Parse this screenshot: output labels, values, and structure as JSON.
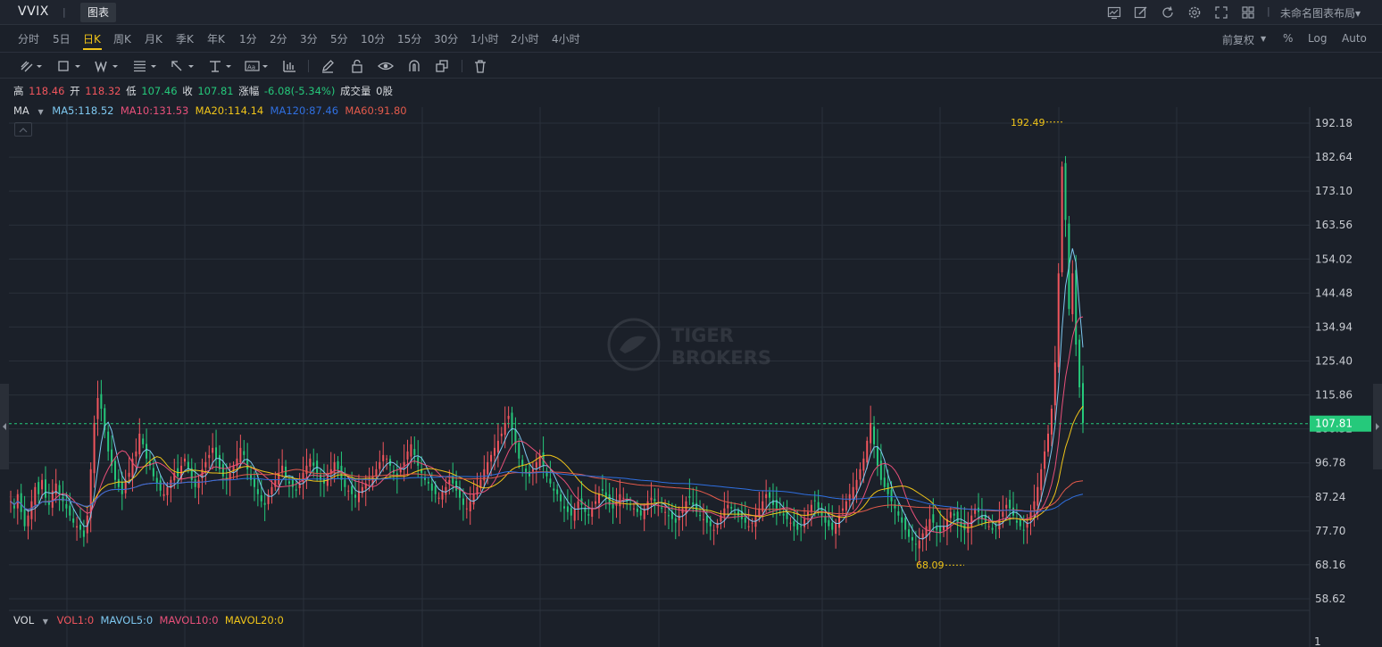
{
  "header": {
    "symbol": "VVIX",
    "separator": "|",
    "tab_label": "图表",
    "layout_label": "未命名图表布局▾"
  },
  "periods": [
    {
      "label": "分时",
      "active": false
    },
    {
      "label": "5日",
      "active": false
    },
    {
      "label": "日K",
      "active": true
    },
    {
      "label": "周K",
      "active": false
    },
    {
      "label": "月K",
      "active": false
    },
    {
      "label": "季K",
      "active": false
    },
    {
      "label": "年K",
      "active": false
    },
    {
      "label": "1分",
      "active": false
    },
    {
      "label": "2分",
      "active": false
    },
    {
      "label": "3分",
      "active": false
    },
    {
      "label": "5分",
      "active": false
    },
    {
      "label": "10分",
      "active": false
    },
    {
      "label": "15分",
      "active": false
    },
    {
      "label": "30分",
      "active": false
    },
    {
      "label": "1小时",
      "active": false
    },
    {
      "label": "2小时",
      "active": false
    },
    {
      "label": "4小时",
      "active": false
    }
  ],
  "right_options": {
    "adjust": "前复权",
    "percent": "%",
    "log": "Log",
    "auto": "Auto"
  },
  "quote": {
    "high_label": "高",
    "high": "118.46",
    "open_label": "开",
    "open": "118.32",
    "low_label": "低",
    "low": "107.46",
    "close_label": "收",
    "close": "107.81",
    "change_label": "涨幅",
    "change": "-6.08(-5.34%)",
    "volume_label": "成交量",
    "volume": "0股"
  },
  "ma": {
    "label": "MA",
    "ma5": "MA5:118.52",
    "ma10": "MA10:131.53",
    "ma20": "MA20:114.14",
    "ma120": "MA120:87.46",
    "ma60": "MA60:91.80"
  },
  "vol": {
    "label": "VOL",
    "vol1": "VOL1:0",
    "mavol5": "MAVOL5:0",
    "mavol10": "MAVOL10:0",
    "mavol20": "MAVOL20:0"
  },
  "colors": {
    "up": "#f0555d",
    "down": "#25c97b",
    "ma5": "#7ec8f0",
    "ma10": "#e8507a",
    "ma20": "#f0c419",
    "ma60": "#e35a4b",
    "ma120": "#2f6fe0",
    "last_price_bg": "#25c97b"
  },
  "watermark": {
    "line1": "TIGER",
    "line2": "BROKERS"
  },
  "chart_data": {
    "type": "candlestick",
    "y_ticks": [
      "192.18",
      "182.64",
      "173.10",
      "163.56",
      "154.02",
      "144.48",
      "134.94",
      "125.40",
      "115.86",
      "106.32",
      "96.78",
      "87.24",
      "77.70",
      "68.16",
      "58.62"
    ],
    "ylim": [
      58.62,
      192.18
    ],
    "high_marker": "192.49",
    "low_marker": "68.09",
    "last_price": "107.81",
    "vol_axis_label": "1",
    "close_series": [
      86,
      84,
      88,
      83,
      79,
      82,
      86,
      90,
      88,
      92,
      87,
      85,
      89,
      91,
      88,
      86,
      84,
      82,
      80,
      79,
      78,
      76,
      82,
      95,
      108,
      115,
      112,
      106,
      100,
      96,
      92,
      90,
      88,
      92,
      94,
      98,
      100,
      105,
      102,
      98,
      96,
      93,
      91,
      89,
      88,
      90,
      92,
      94,
      93,
      96,
      98,
      95,
      92,
      90,
      92,
      95,
      97,
      99,
      101,
      98,
      95,
      93,
      92,
      94,
      96,
      98,
      101,
      99,
      95,
      92,
      90,
      88,
      86,
      85,
      88,
      90,
      92,
      94,
      96,
      93,
      91,
      90,
      89,
      91,
      94,
      96,
      98,
      96,
      94,
      92,
      91,
      93,
      95,
      97,
      95,
      92,
      90,
      89,
      88,
      87,
      89,
      90,
      91,
      92,
      93,
      95,
      97,
      99,
      98,
      96,
      94,
      93,
      95,
      97,
      100,
      102,
      99,
      96,
      94,
      92,
      91,
      89,
      88,
      87,
      89,
      90,
      92,
      91,
      89,
      87,
      85,
      84,
      86,
      88,
      90,
      92,
      95,
      97,
      99,
      101,
      103,
      105,
      108,
      110,
      106,
      102,
      98,
      96,
      94,
      93,
      95,
      97,
      99,
      96,
      93,
      91,
      89,
      88,
      86,
      84,
      83,
      82,
      84,
      86,
      85,
      83,
      82,
      84,
      86,
      88,
      89,
      87,
      85,
      84,
      86,
      88,
      87,
      86,
      85,
      84,
      83,
      82,
      84,
      86,
      87,
      86,
      85,
      84,
      83,
      82,
      81,
      80,
      82,
      84,
      86,
      87,
      85,
      83,
      82,
      81,
      80,
      79,
      78,
      80,
      82,
      84,
      85,
      84,
      83,
      82,
      81,
      80,
      79,
      80,
      82,
      84,
      86,
      88,
      87,
      85,
      84,
      83,
      82,
      81,
      80,
      79,
      78,
      79,
      81,
      83,
      85,
      86,
      84,
      82,
      80,
      79,
      78,
      80,
      82,
      84,
      86,
      88,
      90,
      92,
      95,
      98,
      103,
      108,
      102,
      96,
      92,
      90,
      88,
      86,
      84,
      82,
      80,
      78,
      76,
      75,
      74,
      75,
      77,
      79,
      81,
      80,
      78,
      77,
      79,
      81,
      83,
      82,
      80,
      79,
      78,
      80,
      82,
      84,
      83,
      81,
      80,
      79,
      78,
      79,
      81,
      83,
      85,
      84,
      82,
      80,
      79,
      78,
      80,
      83,
      86,
      90,
      95,
      100,
      105,
      112,
      125,
      150,
      180,
      165,
      140,
      150,
      130,
      118,
      108
    ]
  }
}
